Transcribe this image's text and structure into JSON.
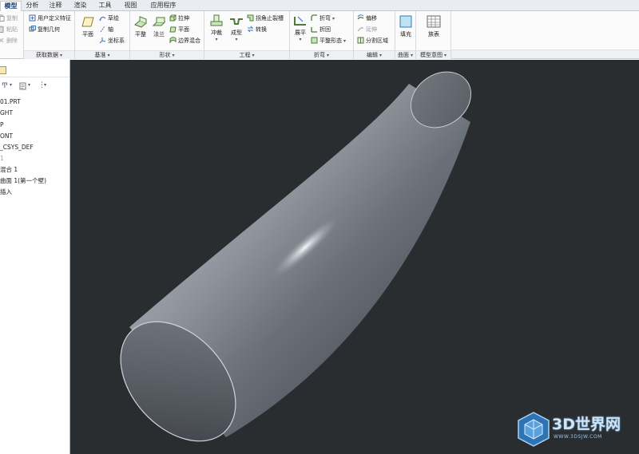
{
  "tabs": [
    "模型",
    "分析",
    "注释",
    "渲染",
    "工具",
    "视图",
    "应用程序"
  ],
  "ribbon": {
    "clipboard": {
      "copy": "复制",
      "paste": "粘贴",
      "delete": "删除"
    },
    "get_data": {
      "label": "获取数据",
      "udf": "用户定义特征",
      "copy_geom": "复制几何"
    },
    "datum": {
      "label": "基准",
      "plane": "平面",
      "sketch": "草绘",
      "axis": "轴",
      "csys": "坐标系"
    },
    "shapes": {
      "label": "形状",
      "flat": "平整",
      "flange": "法兰",
      "extrude": "拉伸",
      "planar": "平面",
      "boundary_blend": "边界混合"
    },
    "engineering": {
      "label": "工程",
      "punch": "冲裁",
      "form": "成型",
      "corner_relief": "拐角止裂槽",
      "convert": "转换"
    },
    "bends": {
      "label": "折弯",
      "unbend": "展平",
      "bend": "折弯",
      "bend_back": "折回",
      "flat_state": "平整形态"
    },
    "editing": {
      "label": "编辑",
      "offset": "偏移",
      "extend": "延伸",
      "split_area": "分割区域"
    },
    "surfaces": {
      "label": "曲面",
      "fill": "填充"
    },
    "model_intent": {
      "label": "模型意图",
      "table": "族表"
    }
  },
  "tree": {
    "items": [
      "01.PRT",
      "GHT",
      "P",
      "ONT",
      "_CSYS_DEF",
      "1",
      "混合 1",
      "曲面 1(第一个壁)",
      "插入"
    ]
  },
  "watermark": {
    "title": "3D世界网",
    "url": "WWW.3DSJW.COM"
  }
}
